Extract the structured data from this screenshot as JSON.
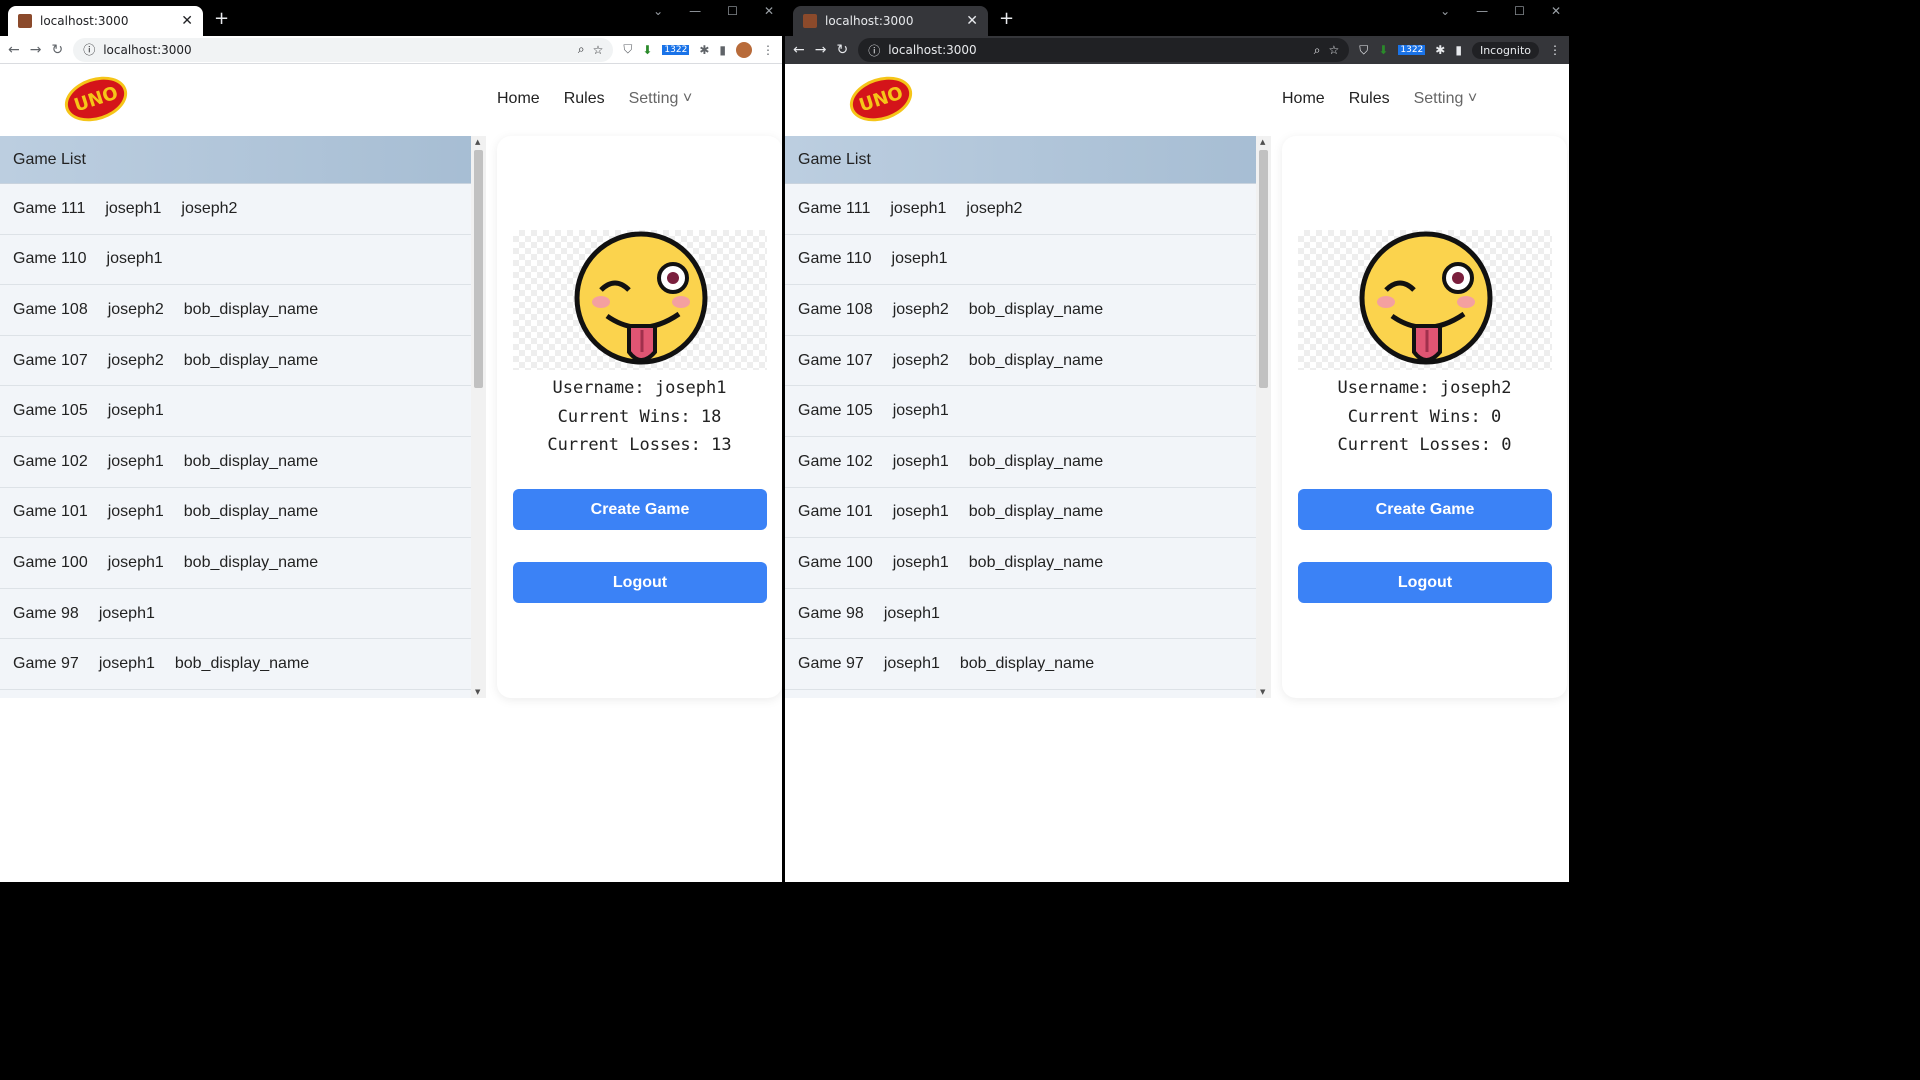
{
  "windows": [
    {
      "theme": "light",
      "tab_title": "localhost:3000",
      "url": "localhost:3000",
      "extension_badge": "1322",
      "profile_label": "",
      "nav": {
        "logo_text": "UNO",
        "links": [
          "Home",
          "Rules",
          "Setting ˅"
        ]
      },
      "game_list_title": "Game List",
      "games": [
        {
          "name": "Game 111",
          "players": [
            "joseph1",
            "joseph2"
          ]
        },
        {
          "name": "Game 110",
          "players": [
            "joseph1"
          ]
        },
        {
          "name": "Game 108",
          "players": [
            "joseph2",
            "bob_display_name"
          ]
        },
        {
          "name": "Game 107",
          "players": [
            "joseph2",
            "bob_display_name"
          ]
        },
        {
          "name": "Game 105",
          "players": [
            "joseph1"
          ]
        },
        {
          "name": "Game 102",
          "players": [
            "joseph1",
            "bob_display_name"
          ]
        },
        {
          "name": "Game 101",
          "players": [
            "joseph1",
            "bob_display_name"
          ]
        },
        {
          "name": "Game 100",
          "players": [
            "joseph1",
            "bob_display_name"
          ]
        },
        {
          "name": "Game 98",
          "players": [
            "joseph1"
          ]
        },
        {
          "name": "Game 97",
          "players": [
            "joseph1",
            "bob_display_name"
          ]
        }
      ],
      "profile": {
        "username": "Username: joseph1",
        "wins": "Current Wins: 18",
        "losses": "Current Losses: 13"
      },
      "buttons": {
        "create": "Create Game",
        "logout": "Logout"
      }
    },
    {
      "theme": "dark",
      "tab_title": "localhost:3000",
      "url": "localhost:3000",
      "extension_badge": "1322",
      "profile_label": "Incognito",
      "nav": {
        "logo_text": "UNO",
        "links": [
          "Home",
          "Rules",
          "Setting ˅"
        ]
      },
      "game_list_title": "Game List",
      "games": [
        {
          "name": "Game 111",
          "players": [
            "joseph1",
            "joseph2"
          ]
        },
        {
          "name": "Game 110",
          "players": [
            "joseph1"
          ]
        },
        {
          "name": "Game 108",
          "players": [
            "joseph2",
            "bob_display_name"
          ]
        },
        {
          "name": "Game 107",
          "players": [
            "joseph2",
            "bob_display_name"
          ]
        },
        {
          "name": "Game 105",
          "players": [
            "joseph1"
          ]
        },
        {
          "name": "Game 102",
          "players": [
            "joseph1",
            "bob_display_name"
          ]
        },
        {
          "name": "Game 101",
          "players": [
            "joseph1",
            "bob_display_name"
          ]
        },
        {
          "name": "Game 100",
          "players": [
            "joseph1",
            "bob_display_name"
          ]
        },
        {
          "name": "Game 98",
          "players": [
            "joseph1"
          ]
        },
        {
          "name": "Game 97",
          "players": [
            "joseph1",
            "bob_display_name"
          ]
        }
      ],
      "profile": {
        "username": "Username: joseph2",
        "wins": "Current Wins: 0",
        "losses": "Current Losses: 0"
      },
      "buttons": {
        "create": "Create Game",
        "logout": "Logout"
      }
    }
  ],
  "colors": {
    "accent": "#3b82f6",
    "list_header": "#a6bdd3",
    "list_bg": "#f2f5f9"
  },
  "icons": [
    "back-arrow-icon",
    "forward-arrow-icon",
    "reload-icon",
    "info-icon",
    "zoom-icon",
    "share-icon",
    "star-icon",
    "puzzle-icon",
    "sidepanel-icon",
    "menu-dots-icon",
    "close-icon"
  ]
}
